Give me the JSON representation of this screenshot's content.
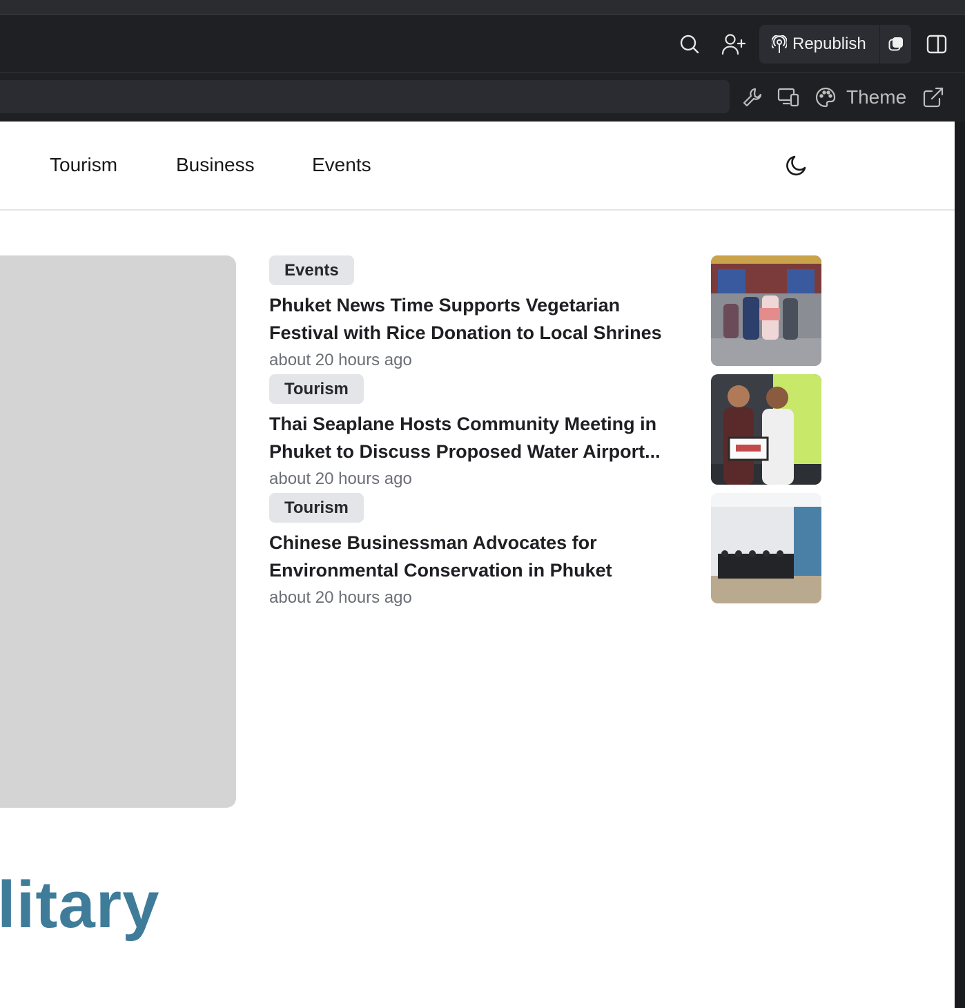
{
  "editor": {
    "republish_label": "Republish",
    "icons": [
      "search-icon",
      "add-user-icon",
      "publish-icon",
      "preview-toggle-icon",
      "sidebar-toggle-icon"
    ]
  },
  "urlbar": {
    "url_value": "",
    "theme_label": "Theme",
    "icons": [
      "wrench-icon",
      "devices-icon",
      "palette-icon",
      "external-link-icon"
    ]
  },
  "nav": {
    "links": [
      "Tourism",
      "Business",
      "Events"
    ],
    "icons": [
      "moon-icon"
    ]
  },
  "articles": [
    {
      "tag": "Events",
      "line1": "Phuket News Time Supports Vegetarian",
      "line2": "Festival with Rice Donation to Local Shrines",
      "time": "about 20 hours ago"
    },
    {
      "tag": "Tourism",
      "line1": "Thai Seaplane Hosts Community Meeting in",
      "line2": "Phuket to Discuss Proposed Water Airport...",
      "time": "about 20 hours ago"
    },
    {
      "tag": "Tourism",
      "line1": "Chinese Businessman Advocates for",
      "line2": "Environmental Conservation in Phuket",
      "time": "about 20 hours ago"
    }
  ],
  "featured": {
    "title_fragment": "litary"
  }
}
